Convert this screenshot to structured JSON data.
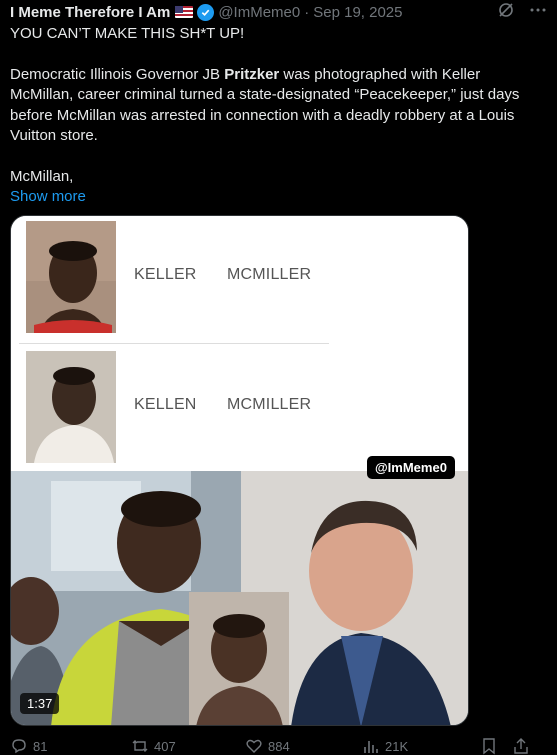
{
  "tweet": {
    "author": {
      "display_name": "I Meme Therefore I Am",
      "flag_icon": "us-flag-icon",
      "verified_icon": "verified-badge-icon",
      "handle": "@ImMeme0",
      "separator": "·",
      "date": "Sep 19, 2025"
    },
    "header_icons": [
      "grok-icon",
      "more-icon"
    ],
    "text": {
      "line1": "YOU CAN’T MAKE THIS SH*T UP!",
      "para2_before": "Democratic Illinois Governor JB ",
      "para2_bold": "Pritzker",
      "para2_after": " was photographed with Keller McMillan, career criminal turned a state-designated “Peacekeeper,” just days before McMillan was arrested in connection with a deadly robbery at a Louis Vuitton store.",
      "para3": "McMillan,",
      "show_more": "Show more"
    },
    "media": {
      "records": [
        {
          "first": "KELLER",
          "last": "MCMILLER"
        },
        {
          "first": "KELLEN",
          "last": "MCMILLER"
        }
      ],
      "watermark": "@ImMeme0",
      "duration": "1:37"
    },
    "actions": {
      "replies": "81",
      "reposts": "407",
      "likes": "884",
      "views": "21K"
    },
    "colors": {
      "background": "#000000",
      "text": "#e7e9ea",
      "muted": "#71767b",
      "link": "#1d9bf0"
    }
  }
}
